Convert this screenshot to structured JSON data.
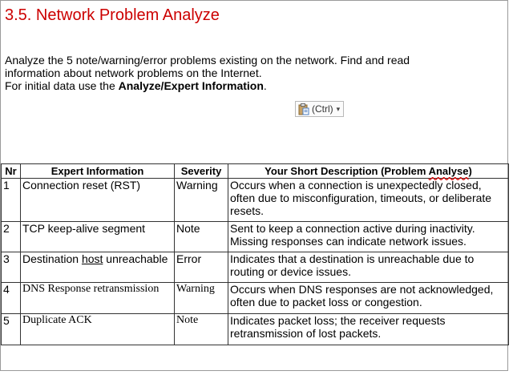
{
  "section": {
    "title": "3.5. Network Problem Analyze",
    "intro_line_1": "Analyze the 5 note/warning/error problems existing on the network. Find and read",
    "intro_line_2": "information about network problems on the Internet.",
    "intro_line_3_prefix": "For initial data use the ",
    "intro_line_3_bold": "Analyze/Expert Information",
    "intro_line_3_suffix": "."
  },
  "paste_options": {
    "label": "(Ctrl)"
  },
  "table": {
    "headers": {
      "nr": "Nr",
      "expert_info": "Expert Information",
      "severity": "Severity",
      "description_prefix": "Your Short Description (Problem ",
      "description_squiggle": "Analyse",
      "description_suffix": ")"
    },
    "rows": [
      {
        "nr": "1",
        "info": "Connection reset (RST)",
        "severity": "Warning",
        "description": " Occurs when a connection is unexpectedly closed, often due to misconfiguration, timeouts, or deliberate resets."
      },
      {
        "nr": "2",
        "info": "TCP keep-alive segment",
        "severity": "Note",
        "description": "Sent to keep a connection active during inactivity. Missing responses can indicate network issues."
      },
      {
        "nr": "3",
        "info_prefix": "Destination ",
        "info_underlined": "host",
        "info_suffix": " unreachable",
        "severity": "Error",
        "description": "Indicates that a destination is unreachable due to routing or device issues."
      },
      {
        "nr": "4",
        "info": "DNS Response retransmission",
        "severity": "Warning",
        "description": "Occurs when DNS responses are not acknowledged, often due to packet loss or congestion."
      },
      {
        "nr": "5",
        "info": "Duplicate ACK",
        "severity": "Note",
        "description": "Indicates packet loss; the receiver requests retransmission of lost packets."
      }
    ]
  }
}
